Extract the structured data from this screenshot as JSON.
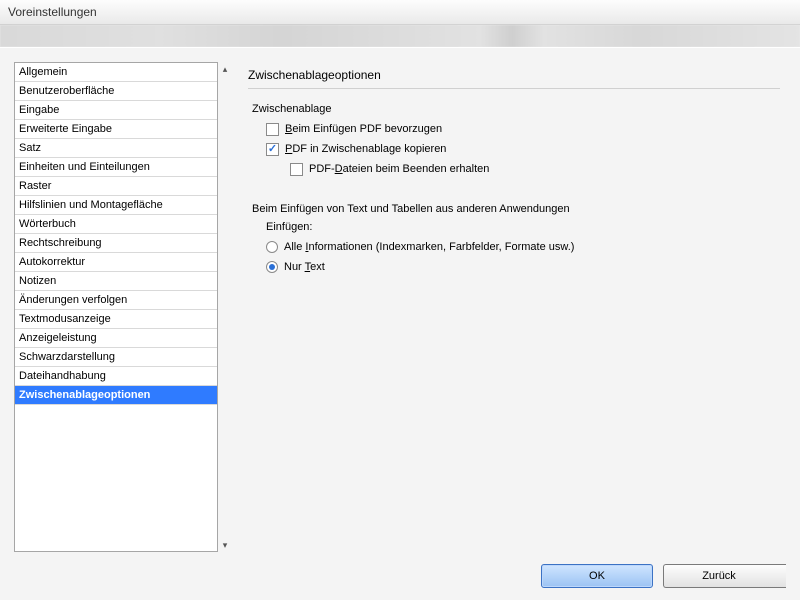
{
  "window": {
    "title": "Voreinstellungen"
  },
  "sidebar": {
    "items": [
      {
        "label": "Allgemein"
      },
      {
        "label": "Benutzeroberfläche"
      },
      {
        "label": "Eingabe"
      },
      {
        "label": "Erweiterte Eingabe"
      },
      {
        "label": "Satz"
      },
      {
        "label": "Einheiten und Einteilungen"
      },
      {
        "label": "Raster"
      },
      {
        "label": "Hilfslinien und Montagefläche"
      },
      {
        "label": "Wörterbuch"
      },
      {
        "label": "Rechtschreibung"
      },
      {
        "label": "Autokorrektur"
      },
      {
        "label": "Notizen"
      },
      {
        "label": "Änderungen verfolgen"
      },
      {
        "label": "Textmodusanzeige"
      },
      {
        "label": "Anzeigeleistung"
      },
      {
        "label": "Schwarzdarstellung"
      },
      {
        "label": "Dateihandhabung"
      },
      {
        "label": "Zwischenablageoptionen"
      }
    ],
    "selected_index": 17
  },
  "panel": {
    "title": "Zwischenablageoptionen",
    "group1": {
      "label": "Zwischenablage",
      "opt_prefer_pdf": {
        "label_pre": "",
        "label_u": "B",
        "label_post": "eim Einfügen PDF bevorzugen",
        "checked": false
      },
      "opt_copy_pdf": {
        "label_pre": "",
        "label_u": "P",
        "label_post": "DF in Zwischenablage kopieren",
        "checked": true
      },
      "opt_keep_pdf": {
        "label_pre": "PDF-",
        "label_u": "D",
        "label_post": "ateien beim Beenden erhalten",
        "checked": false
      }
    },
    "group2": {
      "label": "Beim Einfügen von Text und Tabellen aus anderen Anwendungen",
      "sublabel": "Einfügen:",
      "radio_all": {
        "label_pre": "Alle ",
        "label_u": "I",
        "label_post": "nformationen (Indexmarken, Farbfelder, Formate usw.)",
        "checked": false
      },
      "radio_text": {
        "label_pre": "Nur ",
        "label_u": "T",
        "label_post": "ext",
        "checked": true
      }
    }
  },
  "buttons": {
    "ok": "OK",
    "reset": "Zurück"
  }
}
